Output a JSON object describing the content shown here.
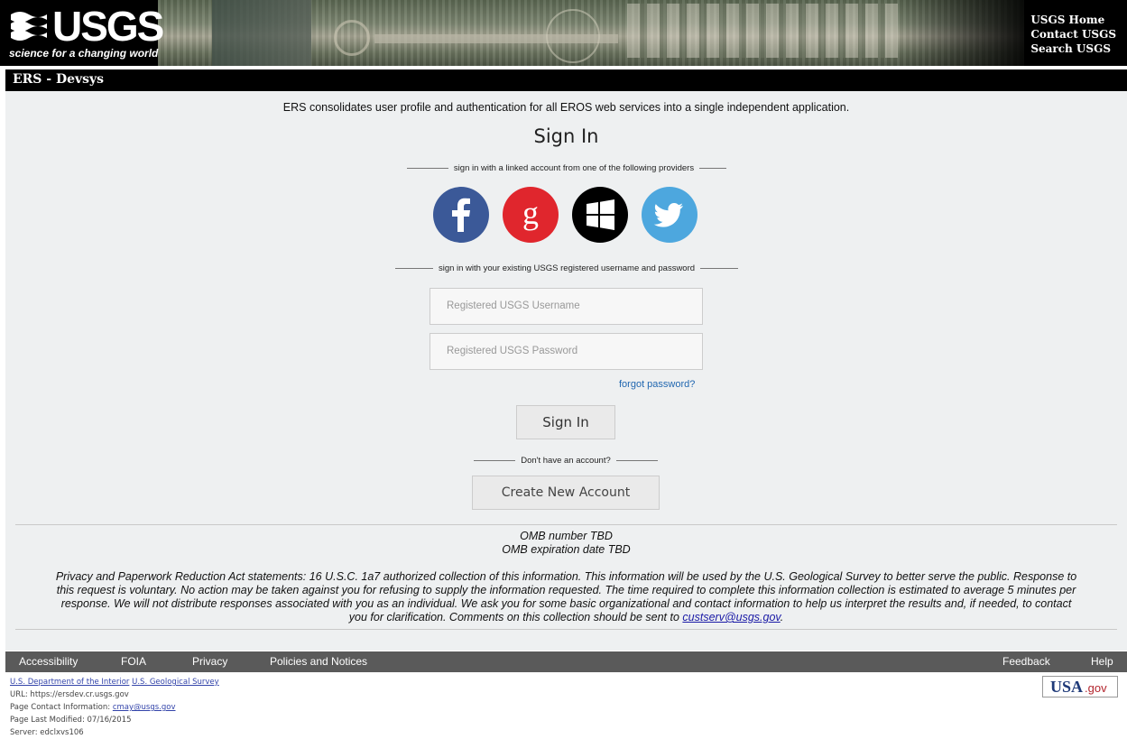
{
  "header": {
    "logo_text": "USGS",
    "tagline": "science for a changing world",
    "links": [
      "USGS Home",
      "Contact USGS",
      "Search USGS"
    ]
  },
  "titlebar": {
    "title": "ERS - Devsys"
  },
  "main": {
    "intro": "ERS consolidates user profile and authentication for all EROS web services into a single independent application.",
    "signin_title": "Sign In",
    "providers_label": "sign in with a linked account from one of the following providers",
    "providers": [
      "facebook-icon",
      "google-icon",
      "windows-icon",
      "twitter-icon"
    ],
    "credentials_label": "sign in with your existing USGS registered username and password",
    "username_placeholder": "Registered USGS Username",
    "password_placeholder": "Registered USGS Password",
    "forgot_password": "forgot password?",
    "signin_button": "Sign In",
    "no_account_label": "Don't have an account?",
    "create_account_button": "Create New Account"
  },
  "omb": {
    "number": "OMB number TBD",
    "expiration": "OMB expiration date TBD"
  },
  "privacy": {
    "text_line1": "Privacy and Paperwork Reduction Act statements: 16 U.S.C. 1a7 authorized collection of this information. This information will be used by the U.S. Geological Survey to better serve the public. Response to",
    "text_line2": "this request is voluntary. No action may be taken against you for refusing to supply the information requested. The time required to complete this information collection is estimated to average 5 minutes per",
    "text_line3": "response. We will not distribute responses associated with you as an individual. We ask you for some basic organizational and contact information to help us interpret the results and, if needed, to contact",
    "text_line4": "you for clarification. Comments on this collection should be sent to",
    "email": "custserv@usgs.gov",
    "trailing": "."
  },
  "footer": {
    "links_left": [
      "Accessibility",
      "FOIA",
      "Privacy",
      "Policies and Notices"
    ],
    "links_right": [
      "Feedback",
      "Help"
    ],
    "dept_link": "U.S. Department of the Interior",
    "usgs_link": "U.S. Geological Survey",
    "url_line": "URL: https://ersdev.cr.usgs.gov",
    "contact_label": "Page Contact Information:",
    "contact_email": "cmay@usgs.gov",
    "modified": "Page Last Modified: 07/16/2015",
    "server": "Server: edclxvs106",
    "usagov_a": "USA",
    "usagov_b": ".gov"
  },
  "colors": {
    "facebook": "#3b5998",
    "google": "#e0262d",
    "windows": "#000000",
    "twitter": "#4da7de",
    "link": "#2167b0",
    "footer_bar": "#5a5a5a"
  }
}
